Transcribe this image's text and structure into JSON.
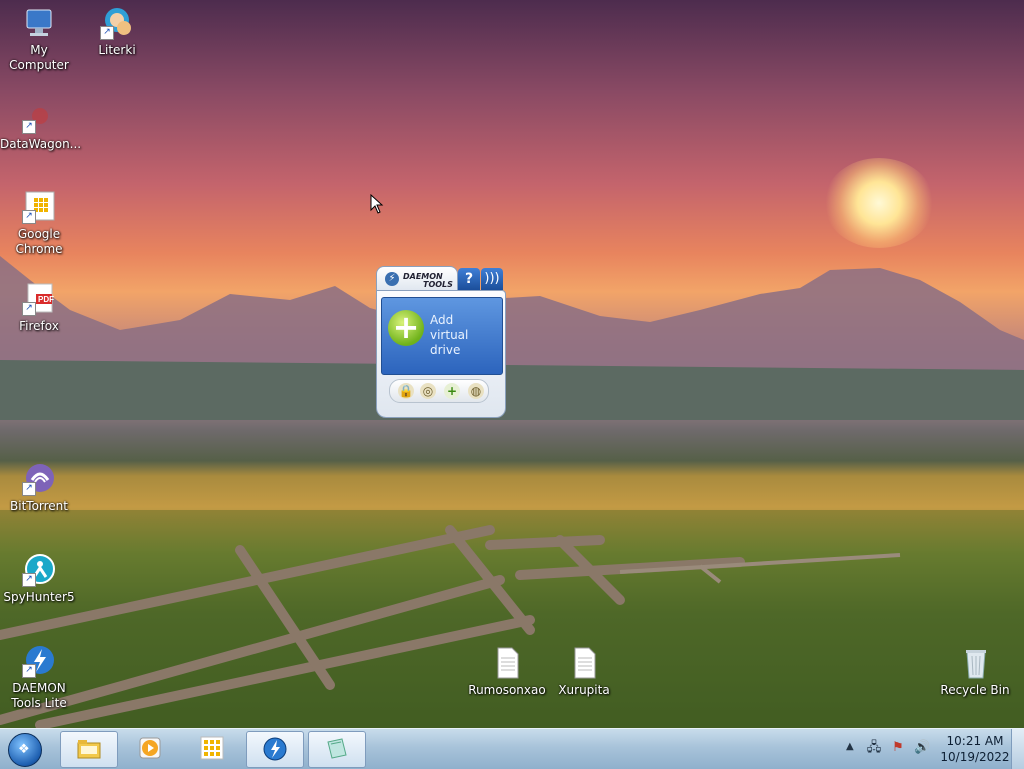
{
  "desktop": {
    "icons_left": [
      {
        "label": "My Computer",
        "icon": "computer-icon"
      },
      {
        "label": "DataWagon...",
        "icon": "datawagon-icon"
      },
      {
        "label": "Google Chrome",
        "icon": "chrome-shortcut-icon"
      },
      {
        "label": "Firefox",
        "icon": "pdf-shortcut-icon"
      },
      {
        "label": "BitTorrent",
        "icon": "bittorrent-icon"
      },
      {
        "label": "SpyHunter5",
        "icon": "spyhunter-icon"
      },
      {
        "label": "DAEMON Tools Lite",
        "icon": "daemon-tools-icon"
      }
    ],
    "icon_literki": {
      "label": "Literki",
      "icon": "literki-icon"
    },
    "files": [
      {
        "label": "Rumosonxao",
        "icon": "document-icon"
      },
      {
        "label": "Xurupita",
        "icon": "document-icon"
      }
    ],
    "recycle_bin": {
      "label": "Recycle Bin",
      "icon": "recycle-bin-icon"
    }
  },
  "gadget": {
    "brand_line1": "DAEMON",
    "brand_line2": "TOOLS",
    "help_label": "?",
    "add_line1": "Add",
    "add_line2": "virtual drive"
  },
  "taskbar": {
    "clock_time": "10:21 AM",
    "clock_date": "10/19/2022"
  },
  "colors": {
    "taskbar": "#a8c3da",
    "gadget_panel": "#2c64bd",
    "add_button": "#6fb21a"
  }
}
